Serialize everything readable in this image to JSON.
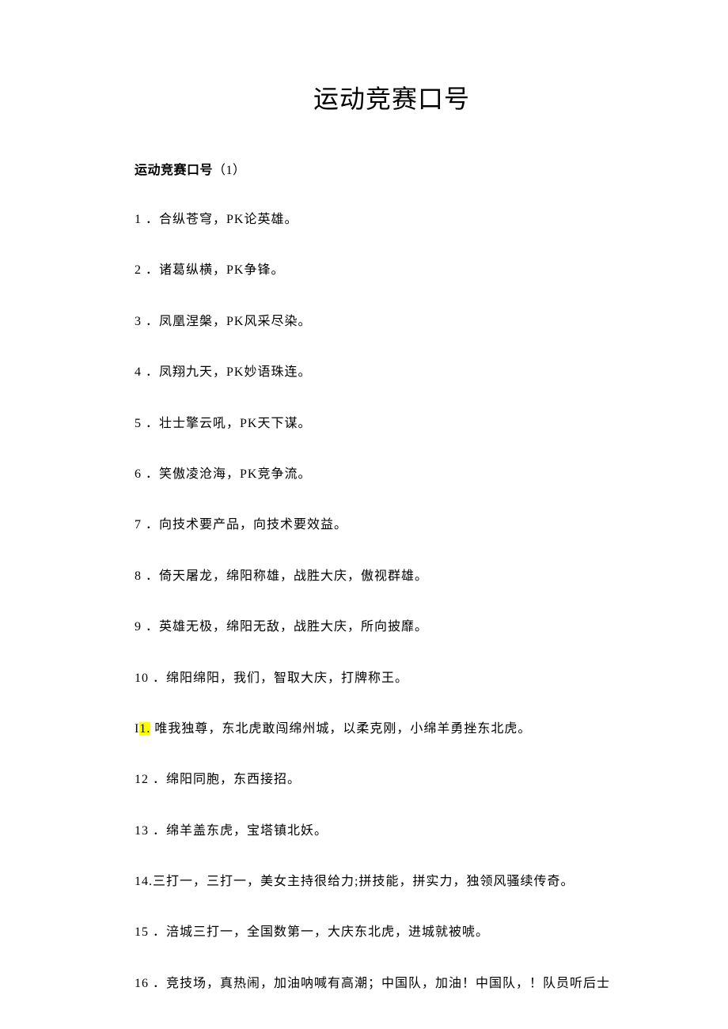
{
  "title": "运动竞赛口号",
  "section": {
    "heading_prefix": "运动竞赛口号",
    "heading_suffix": "（1）"
  },
  "items": [
    {
      "num": "1 ．",
      "text": "合纵苍穹，PK论英雄。"
    },
    {
      "num": "2 ．",
      "text": "诸葛纵横，PK争锋。"
    },
    {
      "num": "3 ．",
      "text": "凤凰涅槃，PK风采尽染。"
    },
    {
      "num": "4 ．",
      "text": "凤翔九天，PK妙语珠连。"
    },
    {
      "num": "5 ．",
      "text": "壮士擎云吼，PK天下谋。"
    },
    {
      "num": "6 ．",
      "text": "笑傲凌沧海，PK竞争流。"
    },
    {
      "num": "7 ．",
      "text": "向技术要产品，向技术要效益。"
    },
    {
      "num": "8 ．",
      "text": "倚天屠龙，绵阳称雄，战胜大庆，傲视群雄。"
    },
    {
      "num": "9 ．",
      "text": "英雄无极，绵阳无敌，战胜大庆，所向披靡。"
    },
    {
      "num": "10 ．",
      "text": "绵阳绵阳，我们，智取大庆，打牌称王。"
    },
    {
      "num_prefix": "I",
      "num_hl": "1.",
      "text": " 唯我独尊，东北虎敢闯绵州城，以柔克刚，小绵羊勇挫东北虎。"
    },
    {
      "num": "12 ．",
      "text": "绵阳同胞，东西接招。"
    },
    {
      "num": "13 ．",
      "text": "绵羊盖东虎，宝塔镇北妖。"
    },
    {
      "num": "14.",
      "text": "三打一，三打一，美女主持很给力;拼技能，拼实力，独领风骚续传奇。"
    },
    {
      "num": "15 ．",
      "text": "涪城三打一，全国数第一，大庆东北虎，进城就被唬。"
    },
    {
      "num": "16 ．",
      "text": "竞技场，真热闹，加油呐喊有高潮；中国队，加油！中国队，！队员听后士"
    }
  ]
}
